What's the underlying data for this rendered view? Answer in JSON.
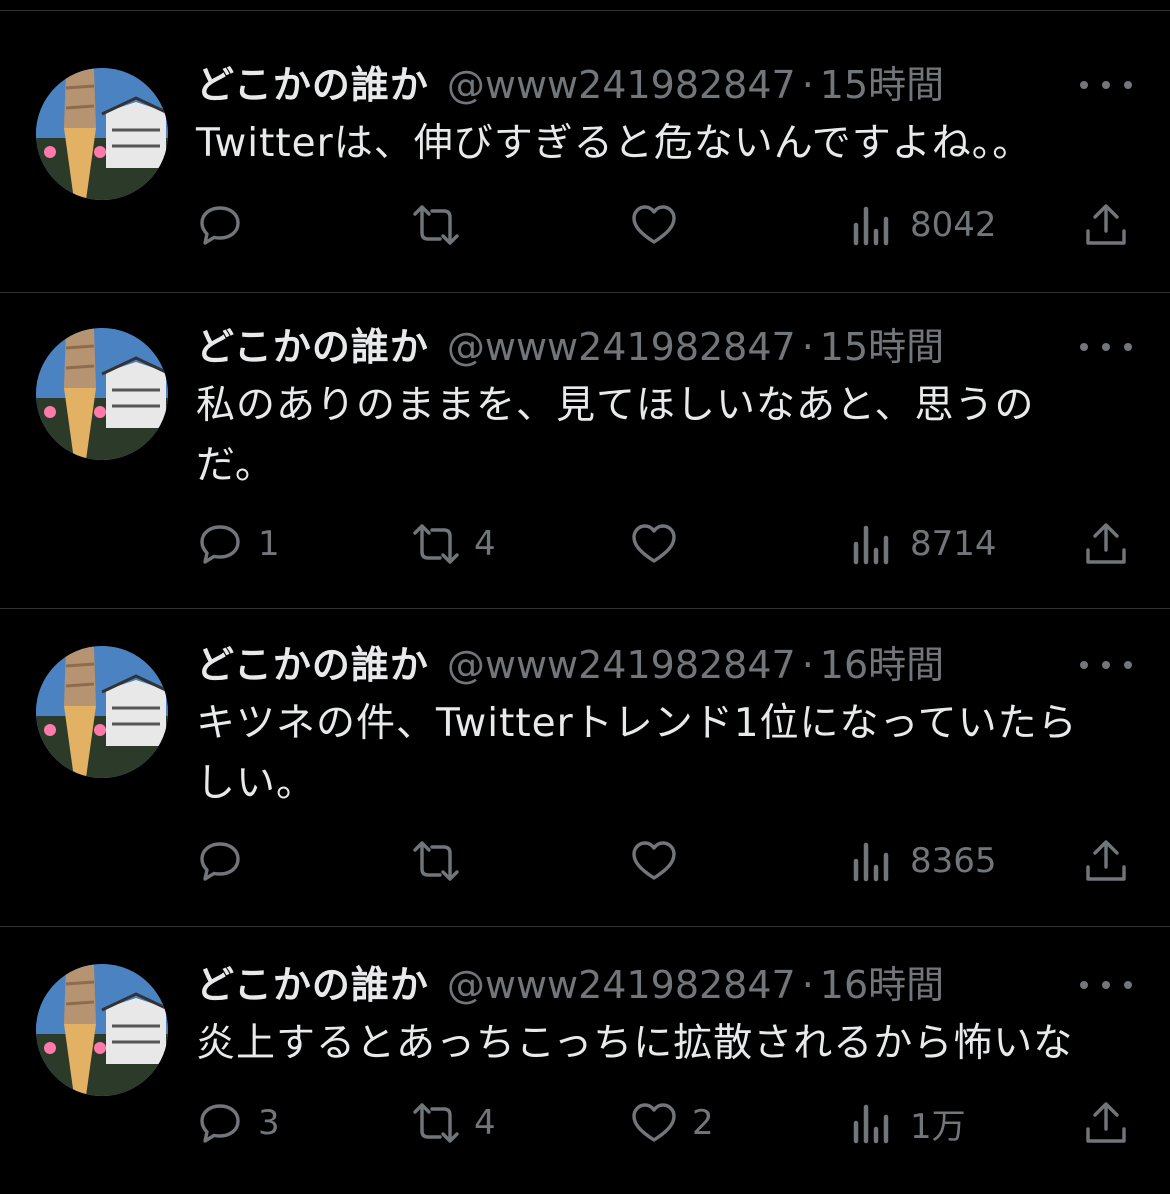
{
  "tweets": [
    {
      "name": "どこかの誰か",
      "handle": "@www241982847",
      "separator": "·",
      "time": "15時間",
      "text": [
        "Twitterは、伸びすぎると危ないんですよね。。"
      ],
      "replies": "",
      "retweets": "",
      "likes": "",
      "views": "8042"
    },
    {
      "name": "どこかの誰か",
      "handle": "@www241982847",
      "separator": "·",
      "time": "15時間",
      "text": [
        "私のありのままを、見てほしいなあと、思うの",
        "だ。"
      ],
      "replies": "1",
      "retweets": "4",
      "likes": "",
      "views": "8714"
    },
    {
      "name": "どこかの誰か",
      "handle": "@www241982847",
      "separator": "·",
      "time": "16時間",
      "text": [
        "キツネの件、Twitterトレンド1位になっていたら",
        "しい。"
      ],
      "replies": "",
      "retweets": "",
      "likes": "",
      "views": "8365"
    },
    {
      "name": "どこかの誰か",
      "handle": "@www241982847",
      "separator": "·",
      "time": "16時間",
      "text": [
        "炎上するとあっちこっちに拡散されるから怖いな"
      ],
      "replies": "3",
      "retweets": "4",
      "likes": "2",
      "views": "1万"
    }
  ],
  "icons": {
    "avatar": "avatar-soft-serve-castle",
    "more": "more-icon",
    "reply": "reply-icon",
    "retweet": "retweet-icon",
    "like": "like-icon",
    "views": "views-icon",
    "share": "share-icon"
  },
  "colors": {
    "background": "#000000",
    "text_primary": "#e7e9ea",
    "text_secondary": "#71767b",
    "divider": "#2f3336"
  }
}
